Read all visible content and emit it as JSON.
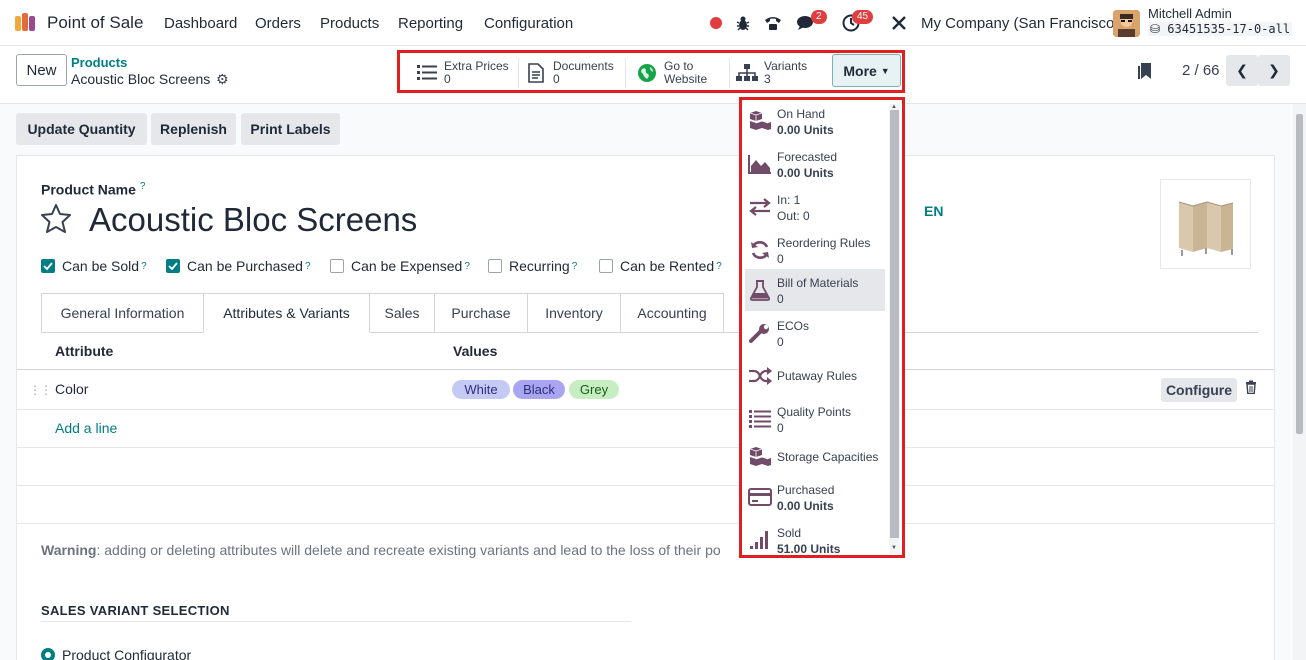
{
  "navbar": {
    "app_name": "Point of Sale",
    "menu": [
      "Dashboard",
      "Orders",
      "Products",
      "Reporting",
      "Configuration"
    ],
    "chat_badge": "2",
    "activity_badge": "45",
    "company": "My Company (San Francisco)",
    "user_name": "Mitchell Admin",
    "db_name": "63451535-17-0-all"
  },
  "control": {
    "new_label": "New",
    "breadcrumb_parent": "Products",
    "breadcrumb_current": "Acoustic Bloc Screens",
    "pager": "2 / 66",
    "smart_buttons": [
      {
        "label": "Extra Prices",
        "value": "0",
        "icon": "list-icon"
      },
      {
        "label": "Documents",
        "value": "0",
        "icon": "document-icon"
      },
      {
        "label": "Go to",
        "value": "Website",
        "icon": "globe-icon"
      },
      {
        "label": "Variants",
        "value": "3",
        "icon": "sitemap-icon"
      }
    ],
    "more_label": "More"
  },
  "actions": [
    "Update Quantity",
    "Replenish",
    "Print Labels"
  ],
  "form": {
    "product_name_label": "Product Name",
    "tooltip_mark": "?",
    "title": "Acoustic Bloc Screens",
    "lang": "EN",
    "checkboxes": [
      {
        "label": "Can be Sold",
        "checked": true
      },
      {
        "label": "Can be Purchased",
        "checked": true
      },
      {
        "label": "Can be Expensed",
        "checked": false
      },
      {
        "label": "Recurring",
        "checked": false
      },
      {
        "label": "Can be Rented",
        "checked": false
      }
    ],
    "tabs": [
      "General Information",
      "Attributes & Variants",
      "Sales",
      "Purchase",
      "Inventory",
      "Accounting"
    ],
    "active_tab": "Attributes & Variants",
    "table": {
      "headers": [
        "Attribute",
        "Values"
      ],
      "rows": [
        {
          "attribute": "Color",
          "values": [
            "White",
            "Black",
            "Grey"
          ]
        }
      ],
      "configure_label": "Configure",
      "add_line": "Add a line"
    },
    "warning_label": "Warning",
    "warning_text": ": adding or deleting attributes will delete and recreate existing variants and lead to the loss of their po",
    "section_title": "SALES VARIANT SELECTION",
    "radio_label": "Product Configurator"
  },
  "dropdown": [
    {
      "label": "On Hand",
      "value": "0.00 Units",
      "icon": "cubes-icon"
    },
    {
      "label": "Forecasted",
      "value": "0.00 Units",
      "icon": "area-chart-icon"
    },
    {
      "label": "In: 1",
      "value": "Out: 0",
      "icon": "exchange-icon"
    },
    {
      "label": "Reordering Rules",
      "value": "0",
      "icon": "refresh-icon"
    },
    {
      "label": "Bill of Materials",
      "value": "0",
      "icon": "flask-icon"
    },
    {
      "label": "ECOs",
      "value": "0",
      "icon": "wrench-icon"
    },
    {
      "label": "Putaway Rules",
      "value": "",
      "icon": "random-icon"
    },
    {
      "label": "Quality Points",
      "value": "0",
      "icon": "list-icon"
    },
    {
      "label": "Storage Capacities",
      "value": "",
      "icon": "cubes-icon"
    },
    {
      "label": "Purchased",
      "value": "0.00 Units",
      "icon": "credit-card-icon"
    },
    {
      "label": "Sold",
      "value": "51.00 Units",
      "icon": "signal-icon"
    }
  ],
  "colors": {
    "accent": "#017e84",
    "highlight_border": "#e02020",
    "pill_white": "#c4c9f5",
    "pill_black": "#a9a5f0",
    "pill_grey": "#c6eec2",
    "icon_purple": "#714b67"
  }
}
